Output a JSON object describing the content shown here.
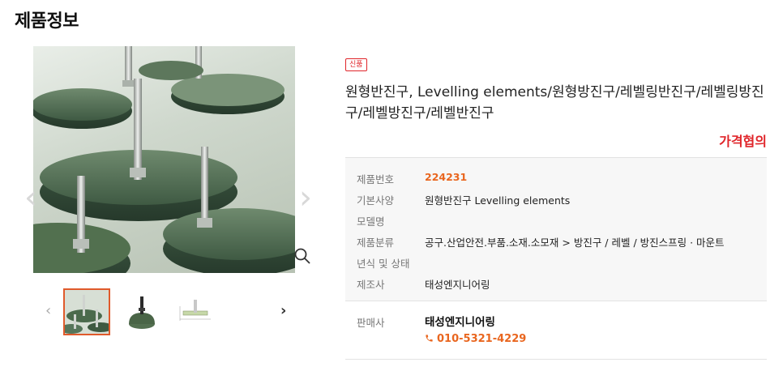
{
  "page": {
    "title": "제품정보"
  },
  "gallery": {
    "prev_arrow": "‹",
    "next_arrow": "›",
    "thumbs_prev": "‹",
    "thumbs_next": "›",
    "thumbnail_count": 3,
    "active_thumbnail": 1
  },
  "product": {
    "badge": "신품",
    "name": "원형반진구, Levelling elements/원형방진구/레벨링반진구/레벨링방진구/레벨방진구/레벨반진구",
    "price": "가격협의"
  },
  "specs": [
    {
      "key": "제품번호",
      "value": "224231"
    },
    {
      "key": "기본사양",
      "value": "원형반진구 Levelling elements"
    },
    {
      "key": "모델명",
      "value": ""
    },
    {
      "key": "제품분류",
      "value": "공구.산업안전.부품.소재.소모재 > 방진구 / 레벨 / 방진스프링 · 마운트"
    },
    {
      "key": "년식 및 상태",
      "value": ""
    },
    {
      "key": "제조사",
      "value": "태성엔지니어링"
    }
  ],
  "seller": {
    "label": "판매사",
    "name": "태성엔지니어링",
    "phone": "010-5321-4229"
  },
  "icons": {
    "zoom": "magnifier-icon",
    "phone": "phone-icon"
  },
  "colors": {
    "accent": "#e9661f",
    "price": "#e0252a",
    "badge": "#e0252a"
  }
}
